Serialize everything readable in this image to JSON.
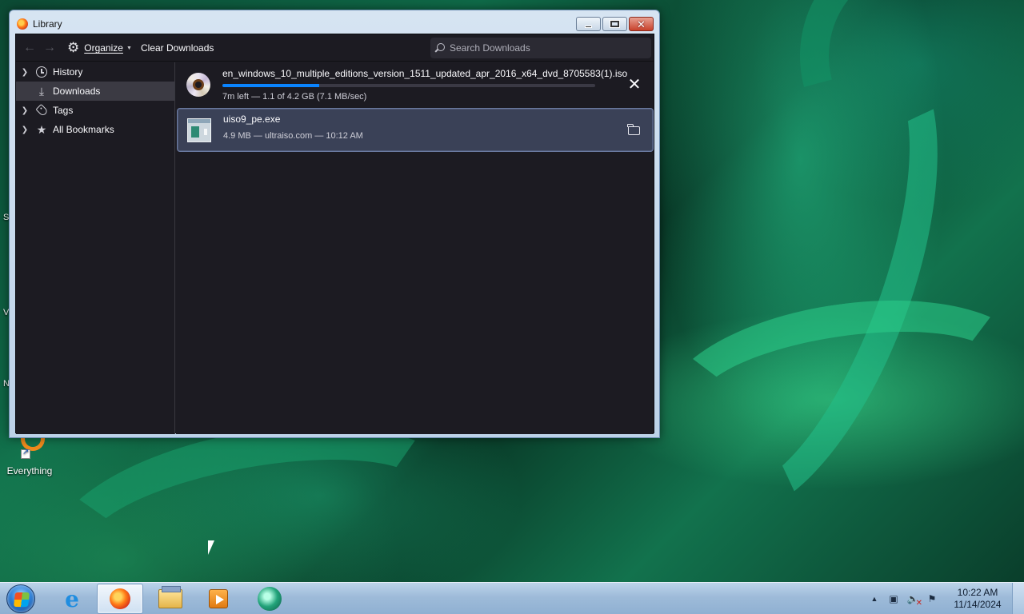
{
  "window": {
    "title": "Library",
    "buttons": {
      "minimize": "minimize",
      "maximize": "maximize",
      "close": "close"
    }
  },
  "toolbar": {
    "back_icon": "back-arrow-icon",
    "forward_icon": "forward-arrow-icon",
    "organize_label": "Organize",
    "clear_label": "Clear Downloads",
    "search_placeholder": "Search Downloads"
  },
  "sidebar": {
    "items": [
      {
        "label": "History",
        "icon": "clock-icon",
        "expandable": true,
        "selected": false
      },
      {
        "label": "Downloads",
        "icon": "download-icon",
        "expandable": false,
        "selected": true
      },
      {
        "label": "Tags",
        "icon": "tag-icon",
        "expandable": true,
        "selected": false
      },
      {
        "label": "All Bookmarks",
        "icon": "star-icon",
        "expandable": true,
        "selected": false
      }
    ]
  },
  "downloads": [
    {
      "filename": "en_windows_10_multiple_editions_version_1511_updated_apr_2016_x64_dvd_8705583(1).iso",
      "status": "7m left — 1.1 of 4.2 GB (7.1 MB/sec)",
      "progress": 0.26,
      "icon": "disc-icon",
      "action": "cancel-icon"
    },
    {
      "filename": "uiso9_pe.exe",
      "status": "4.9 MB — ultraiso.com — 10:12 AM",
      "icon": "exe-file-icon",
      "action": "folder-icon"
    }
  ],
  "desktop": {
    "icons": [
      {
        "label": "Everything"
      }
    ],
    "edge_letters": [
      "S",
      "V",
      "N"
    ]
  },
  "taskbar": {
    "apps": [
      "internet-explorer",
      "firefox",
      "file-explorer",
      "media-player",
      "navigation-app"
    ],
    "active_app": "firefox",
    "clock": {
      "time": "10:22 AM",
      "date": "11/14/2024"
    }
  },
  "colors": {
    "accent": "#0a84ff",
    "window_bg": "#1c1b22",
    "selected_row": "#3a4157",
    "sidebar_selected": "#3b3a43"
  }
}
